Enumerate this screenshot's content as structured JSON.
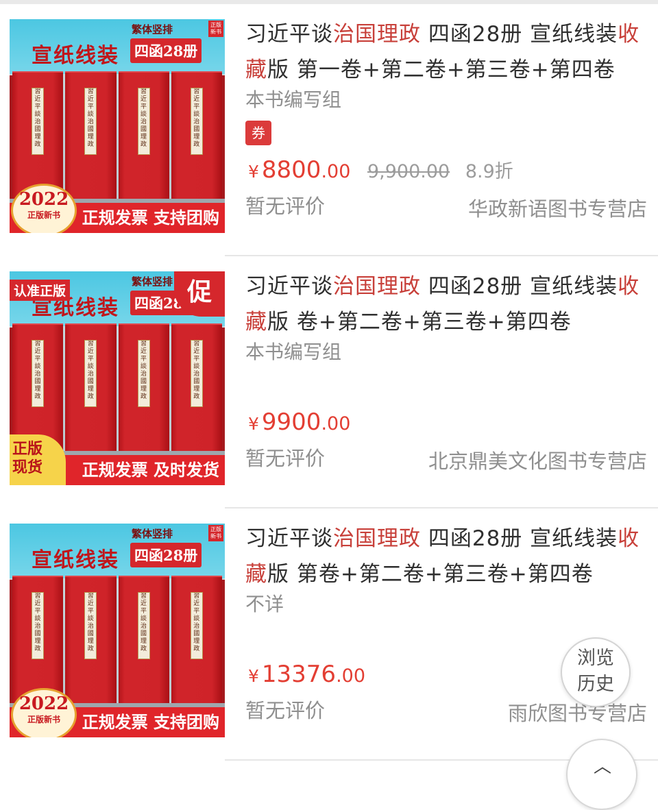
{
  "products": [
    {
      "thumb": {
        "text_top": "繁体竖排",
        "title": "宣纸线装",
        "badge": "四函28册",
        "corner": "正版新书",
        "year": "2022",
        "year_sub": "正版新书",
        "footer": "正规发票 支持团购",
        "spine": "習近平談治國理政"
      },
      "title_segments": [
        {
          "text": "习近平谈",
          "hl": false
        },
        {
          "text": "治国理政",
          "hl": true
        },
        {
          "text": " 四函28册 宣纸线装",
          "hl": false
        },
        {
          "text": "收藏",
          "hl": true
        },
        {
          "text": "版 第一卷+第二卷+第三卷+第四卷",
          "hl": false
        }
      ],
      "author": "本书编写组",
      "coupon": "券",
      "price": {
        "symbol": "¥",
        "int": "8800",
        "dec": ".00"
      },
      "original_price": "9,900.00",
      "discount": "8.9折",
      "reviews": "暂无评价",
      "shop": "华政新语图书专营店"
    },
    {
      "thumb": {
        "text_top": "繁体竖排",
        "title": "宣纸线装",
        "badge": "四函28册",
        "auth": "认准正版",
        "promo": "促",
        "stock": "正版\n现货",
        "footer": "正规发票 及时发货",
        "spine": "習近平談治國理政"
      },
      "title_segments": [
        {
          "text": "习近平谈",
          "hl": false
        },
        {
          "text": "治国理政",
          "hl": true
        },
        {
          "text": " 四函28册 宣纸线装",
          "hl": false
        },
        {
          "text": "收藏",
          "hl": true
        },
        {
          "text": "版 卷+第二卷+第三卷+第四卷",
          "hl": false
        }
      ],
      "author": "本书编写组",
      "price": {
        "symbol": "¥",
        "int": "9900",
        "dec": ".00"
      },
      "reviews": "暂无评价",
      "shop": "北京鼎美文化图书专营店"
    },
    {
      "thumb": {
        "text_top": "繁体竖排",
        "title": "宣纸线装",
        "badge": "四函28册",
        "corner": "正版新书",
        "year": "2022",
        "year_sub": "正版新书",
        "footer": "正规发票 支持团购",
        "spine": "習近平談治國理政"
      },
      "title_segments": [
        {
          "text": "习近平谈",
          "hl": false
        },
        {
          "text": "治国理政",
          "hl": true
        },
        {
          "text": " 四函28册 宣纸线装",
          "hl": false
        },
        {
          "text": "收藏",
          "hl": true
        },
        {
          "text": "版 第卷+第二卷+第三卷+第四卷",
          "hl": false
        }
      ],
      "author": "不详",
      "price": {
        "symbol": "¥",
        "int": "13376",
        "dec": ".00"
      },
      "reviews": "暂无评价",
      "shop": "雨欣图书专营店"
    }
  ],
  "floating": {
    "history": "浏览\n历史",
    "back_top_icon": "arrow-up-icon"
  }
}
